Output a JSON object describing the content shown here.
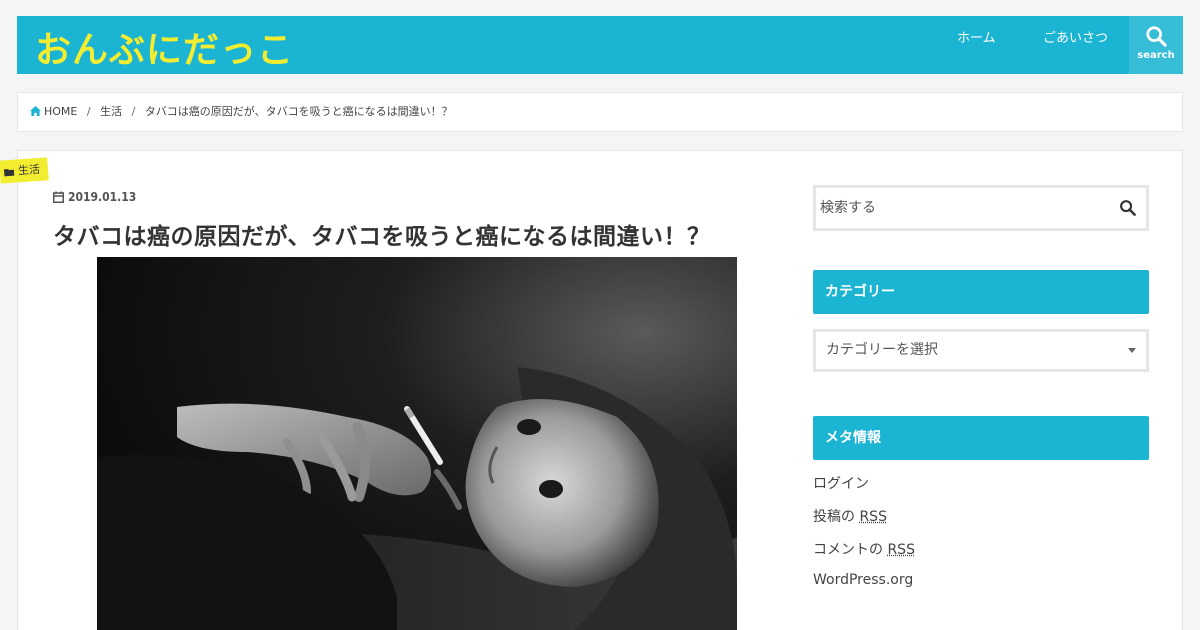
{
  "site": {
    "logo": "おんぶにだっこ"
  },
  "nav": {
    "items": [
      {
        "label": "ホーム"
      },
      {
        "label": "ごあいさつ"
      }
    ],
    "search_label": "search"
  },
  "breadcrumb": {
    "home": "HOME",
    "category": "生活",
    "current": "タバコは癌の原因だが、タバコを吸うと癌になるは間違い！？"
  },
  "post": {
    "category": "生活",
    "date": "2019.01.13",
    "title": "タバコは癌の原因だが、タバコを吸うと癌になるは間違い！？"
  },
  "sidebar": {
    "search_placeholder": "検索する",
    "categories_title": "カテゴリー",
    "category_select": "カテゴリーを選択",
    "meta_title": "メタ情報",
    "meta_links": {
      "login": "ログイン",
      "posts_prefix": "投稿の ",
      "posts_rss": "RSS",
      "comments_prefix": "コメントの ",
      "comments_rss": "RSS",
      "wordpress": "WordPress.org"
    }
  },
  "colors": {
    "accent": "#1bb4d3",
    "logo": "#f2ed30",
    "badge": "#f2ed30"
  }
}
